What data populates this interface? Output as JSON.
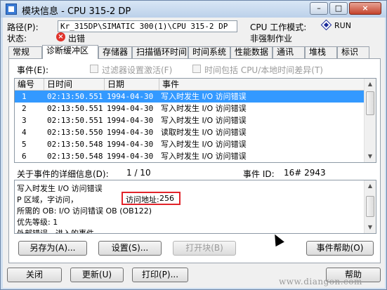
{
  "window": {
    "title": "模块信息 - CPU 315-2 DP",
    "controls": {
      "minimize": "–",
      "maximize": "□",
      "close": "×"
    }
  },
  "header": {
    "path_label": "路径(P):",
    "path_value": "Kr_315DP\\SIMATIC 300(1)\\CPU 315-2 DP",
    "cpu_mode_label": "CPU 工作模式:",
    "cpu_mode_value": "RUN",
    "status_label": "状态:",
    "status_value": "出错",
    "force_value": "非强制作业"
  },
  "tabs": [
    "常规",
    "诊断缓冲区",
    "存储器",
    "扫描循环时间",
    "时间系统",
    "性能数据",
    "通讯",
    "堆栈",
    "标识"
  ],
  "active_tab": "诊断缓冲区",
  "events": {
    "label": "事件(E):",
    "filter_label": "过滤器设置激活(F)",
    "time_label": "时间包括 CPU/本地时间差异(T)",
    "columns": [
      "编号",
      "日时间",
      "日期",
      "事件"
    ],
    "rows": [
      {
        "no": "1",
        "time": "02:13:50.551",
        "date": "1994-04-30",
        "event": "写入时发生 I/O 访问错误"
      },
      {
        "no": "2",
        "time": "02:13:50.551",
        "date": "1994-04-30",
        "event": "写入时发生 I/O 访问错误"
      },
      {
        "no": "3",
        "time": "02:13:50.551",
        "date": "1994-04-30",
        "event": "写入时发生 I/O 访问错误"
      },
      {
        "no": "4",
        "time": "02:13:50.550",
        "date": "1994-04-30",
        "event": "读取时发生 I/O 访问错误"
      },
      {
        "no": "5",
        "time": "02:13:50.548",
        "date": "1994-04-30",
        "event": "写入时发生 I/O 访问错误"
      },
      {
        "no": "6",
        "time": "02:13:50.548",
        "date": "1994-04-30",
        "event": "写入时发生 I/O 访问错误"
      }
    ],
    "selected_index": 0
  },
  "details": {
    "label": "关于事件的详细信息(D):",
    "count": "1 / 10",
    "event_id_label": "事件 ID:",
    "event_id_value": "16# 2943",
    "lines": [
      "写入时发生 I/O 访问错误",
      "P 区域，字访问，",
      "访问地址:",
      "256",
      "所需的 OB: I/O 访问错误 OB (OB122)",
      "优先等级: 1",
      "外部错误，进入的事件"
    ]
  },
  "panel_buttons": {
    "save_as": "另存为(A)...",
    "settings": "设置(S)...",
    "open_block": "打开块(B)",
    "event_help": "事件帮助(O)"
  },
  "footer_buttons": {
    "close": "关闭",
    "update": "更新(U)",
    "print": "打印(P)...",
    "help": "帮助"
  },
  "watermark": "www.diangon.com"
}
